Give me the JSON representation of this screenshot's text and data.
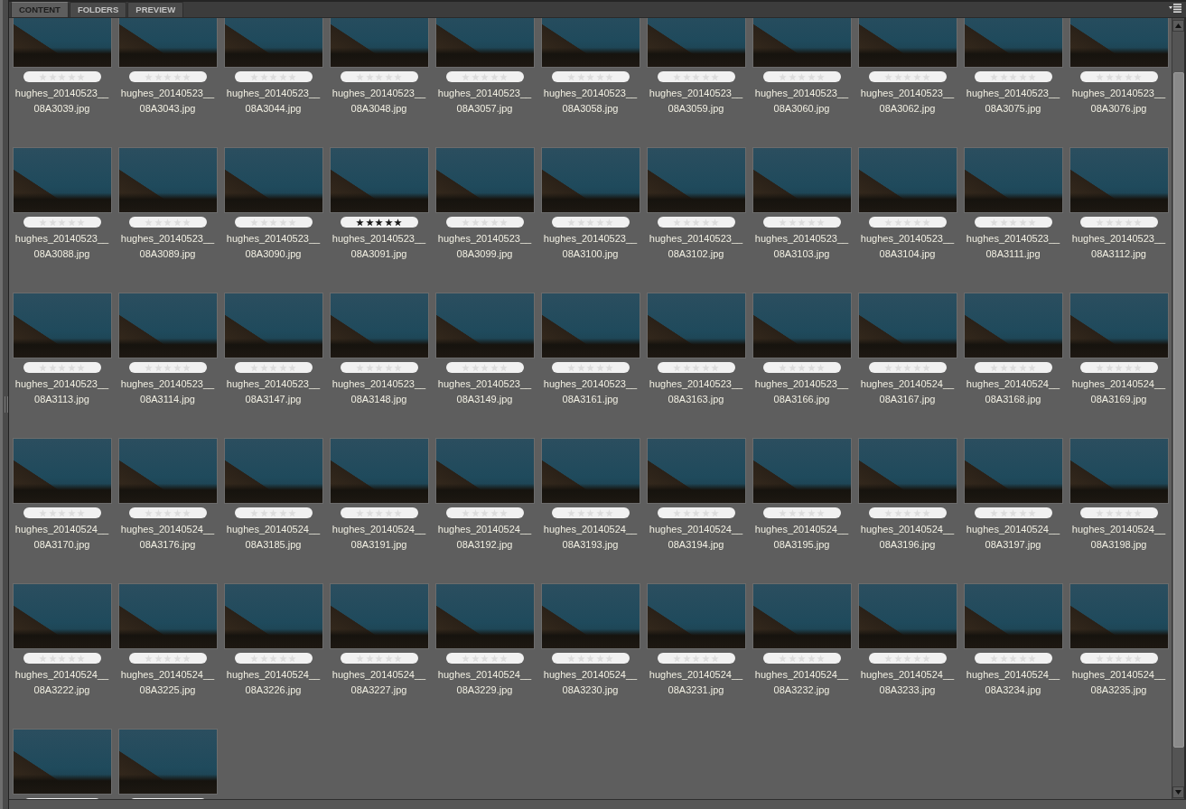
{
  "tabs": [
    {
      "label": "CONTENT",
      "selected": true
    },
    {
      "label": "FOLDERS",
      "selected": false
    },
    {
      "label": "PREVIEW",
      "selected": false
    }
  ],
  "thumbnails": [
    {
      "kind": "file",
      "label_lines": [
        "hughes_20140523__",
        "08A3039.jpg"
      ],
      "stars": 0
    },
    {
      "kind": "file",
      "label_lines": [
        "hughes_20140523__",
        "08A3043.jpg"
      ],
      "stars": 0
    },
    {
      "kind": "file",
      "label_lines": [
        "hughes_20140523__",
        "08A3044.jpg"
      ],
      "stars": 0
    },
    {
      "kind": "file",
      "label_lines": [
        "hughes_20140523__",
        "08A3048.jpg"
      ],
      "stars": 0
    },
    {
      "kind": "file",
      "label_lines": [
        "hughes_20140523__",
        "08A3057.jpg"
      ],
      "stars": 0
    },
    {
      "kind": "file",
      "label_lines": [
        "hughes_20140523__",
        "08A3058.jpg"
      ],
      "stars": 0
    },
    {
      "kind": "file",
      "label_lines": [
        "hughes_20140523__",
        "08A3059.jpg"
      ],
      "stars": 0
    },
    {
      "kind": "file",
      "label_lines": [
        "hughes_20140523__",
        "08A3060.jpg"
      ],
      "stars": 0
    },
    {
      "kind": "file",
      "label_lines": [
        "hughes_20140523__",
        "08A3062.jpg"
      ],
      "stars": 0
    },
    {
      "kind": "file",
      "label_lines": [
        "hughes_20140523__",
        "08A3075.jpg"
      ],
      "stars": 0
    },
    {
      "kind": "file",
      "label_lines": [
        "hughes_20140523__",
        "08A3076.jpg"
      ],
      "stars": 0
    },
    {
      "kind": "file",
      "label_lines": [
        "hughes_20140523__",
        "08A3088.jpg"
      ],
      "stars": 0
    },
    {
      "kind": "file",
      "label_lines": [
        "hughes_20140523__",
        "08A3089.jpg"
      ],
      "stars": 0
    },
    {
      "kind": "file",
      "label_lines": [
        "hughes_20140523__",
        "08A3090.jpg"
      ],
      "stars": 0
    },
    {
      "kind": "file",
      "label_lines": [
        "hughes_20140523__",
        "08A3091.jpg"
      ],
      "stars": 5
    },
    {
      "kind": "file",
      "label_lines": [
        "hughes_20140523__",
        "08A3099.jpg"
      ],
      "stars": 0
    },
    {
      "kind": "file",
      "label_lines": [
        "hughes_20140523__",
        "08A3100.jpg"
      ],
      "stars": 0
    },
    {
      "kind": "file",
      "label_lines": [
        "hughes_20140523__",
        "08A3102.jpg"
      ],
      "stars": 0
    },
    {
      "kind": "file",
      "label_lines": [
        "hughes_20140523__",
        "08A3103.jpg"
      ],
      "stars": 0
    },
    {
      "kind": "file",
      "label_lines": [
        "hughes_20140523__",
        "08A3104.jpg"
      ],
      "stars": 0
    },
    {
      "kind": "file",
      "label_lines": [
        "hughes_20140523__",
        "08A3111.jpg"
      ],
      "stars": 0
    },
    {
      "kind": "file",
      "label_lines": [
        "hughes_20140523__",
        "08A3112.jpg"
      ],
      "stars": 0
    },
    {
      "kind": "file",
      "label_lines": [
        "hughes_20140523__",
        "08A3113.jpg"
      ],
      "stars": 0
    },
    {
      "kind": "file",
      "label_lines": [
        "hughes_20140523__",
        "08A3114.jpg"
      ],
      "stars": 0
    },
    {
      "kind": "file",
      "label_lines": [
        "hughes_20140523__",
        "08A3147.jpg"
      ],
      "stars": 0
    },
    {
      "kind": "file",
      "label_lines": [
        "hughes_20140523__",
        "08A3148.jpg"
      ],
      "stars": 0
    },
    {
      "kind": "file",
      "label_lines": [
        "hughes_20140523__",
        "08A3149.jpg"
      ],
      "stars": 0
    },
    {
      "kind": "file",
      "label_lines": [
        "hughes_20140523__",
        "08A3161.jpg"
      ],
      "stars": 0
    },
    {
      "kind": "file",
      "label_lines": [
        "hughes_20140523__",
        "08A3163.jpg"
      ],
      "stars": 0
    },
    {
      "kind": "file",
      "label_lines": [
        "hughes_20140523__",
        "08A3166.jpg"
      ],
      "stars": 0
    },
    {
      "kind": "file",
      "label_lines": [
        "hughes_20140524__",
        "08A3167.jpg"
      ],
      "stars": 0
    },
    {
      "kind": "file",
      "label_lines": [
        "hughes_20140524__",
        "08A3168.jpg"
      ],
      "stars": 0
    },
    {
      "kind": "file",
      "label_lines": [
        "hughes_20140524__",
        "08A3169.jpg"
      ],
      "stars": 0
    },
    {
      "kind": "file",
      "label_lines": [
        "hughes_20140524__",
        "08A3170.jpg"
      ],
      "stars": 0
    },
    {
      "kind": "file",
      "label_lines": [
        "hughes_20140524__",
        "08A3176.jpg"
      ],
      "stars": 0
    },
    {
      "kind": "file",
      "label_lines": [
        "hughes_20140524__",
        "08A3185.jpg"
      ],
      "stars": 0
    },
    {
      "kind": "file",
      "label_lines": [
        "hughes_20140524__",
        "08A3191.jpg"
      ],
      "stars": 0
    },
    {
      "kind": "file",
      "label_lines": [
        "hughes_20140524__",
        "08A3192.jpg"
      ],
      "stars": 0
    },
    {
      "kind": "file",
      "label_lines": [
        "hughes_20140524__",
        "08A3193.jpg"
      ],
      "stars": 0
    },
    {
      "kind": "file",
      "label_lines": [
        "hughes_20140524__",
        "08A3194.jpg"
      ],
      "stars": 0
    },
    {
      "kind": "file",
      "label_lines": [
        "hughes_20140524__",
        "08A3195.jpg"
      ],
      "stars": 0
    },
    {
      "kind": "file",
      "label_lines": [
        "hughes_20140524__",
        "08A3196.jpg"
      ],
      "stars": 0
    },
    {
      "kind": "file",
      "label_lines": [
        "hughes_20140524__",
        "08A3197.jpg"
      ],
      "stars": 0
    },
    {
      "kind": "file",
      "label_lines": [
        "hughes_20140524__",
        "08A3198.jpg"
      ],
      "stars": 0
    },
    {
      "kind": "file",
      "label_lines": [
        "hughes_20140524__",
        "08A3222.jpg"
      ],
      "stars": 0
    },
    {
      "kind": "file",
      "label_lines": [
        "hughes_20140524__",
        "08A3225.jpg"
      ],
      "stars": 0
    },
    {
      "kind": "file",
      "label_lines": [
        "hughes_20140524__",
        "08A3226.jpg"
      ],
      "stars": 0
    },
    {
      "kind": "file",
      "label_lines": [
        "hughes_20140524__",
        "08A3227.jpg"
      ],
      "stars": 0
    },
    {
      "kind": "file",
      "label_lines": [
        "hughes_20140524__",
        "08A3229.jpg"
      ],
      "stars": 0
    },
    {
      "kind": "file",
      "label_lines": [
        "hughes_20140524__",
        "08A3230.jpg"
      ],
      "stars": 0
    },
    {
      "kind": "file",
      "label_lines": [
        "hughes_20140524__",
        "08A3231.jpg"
      ],
      "stars": 0
    },
    {
      "kind": "file",
      "label_lines": [
        "hughes_20140524__",
        "08A3232.jpg"
      ],
      "stars": 0
    },
    {
      "kind": "file",
      "label_lines": [
        "hughes_20140524__",
        "08A3233.jpg"
      ],
      "stars": 0
    },
    {
      "kind": "file",
      "label_lines": [
        "hughes_20140524__",
        "08A3234.jpg"
      ],
      "stars": 0
    },
    {
      "kind": "file",
      "label_lines": [
        "hughes_20140524__",
        "08A3235.jpg"
      ],
      "stars": 0
    },
    {
      "kind": "clipped"
    },
    {
      "kind": "clipped"
    }
  ]
}
